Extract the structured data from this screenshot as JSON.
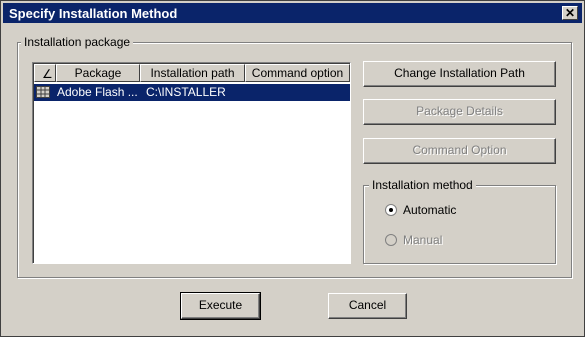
{
  "window": {
    "title": "Specify Installation Method"
  },
  "install_package": {
    "legend": "Installation package",
    "columns": [
      "Package",
      "Installation path",
      "Command option"
    ],
    "rows": [
      {
        "package": "Adobe Flash ...",
        "path": "C:\\INSTALLER",
        "command": ""
      }
    ]
  },
  "buttons": {
    "change_path": "Change Installation Path",
    "package_details": "Package Details",
    "command_option": "Command Option",
    "execute": "Execute",
    "cancel": "Cancel"
  },
  "install_method": {
    "legend": "Installation method",
    "options": [
      {
        "label": "Automatic",
        "selected": true,
        "enabled": true
      },
      {
        "label": "Manual",
        "selected": false,
        "enabled": false
      }
    ]
  },
  "colors": {
    "titlebar": "#0a246a",
    "face": "#d4d0c8",
    "selection": "#0a246a"
  }
}
